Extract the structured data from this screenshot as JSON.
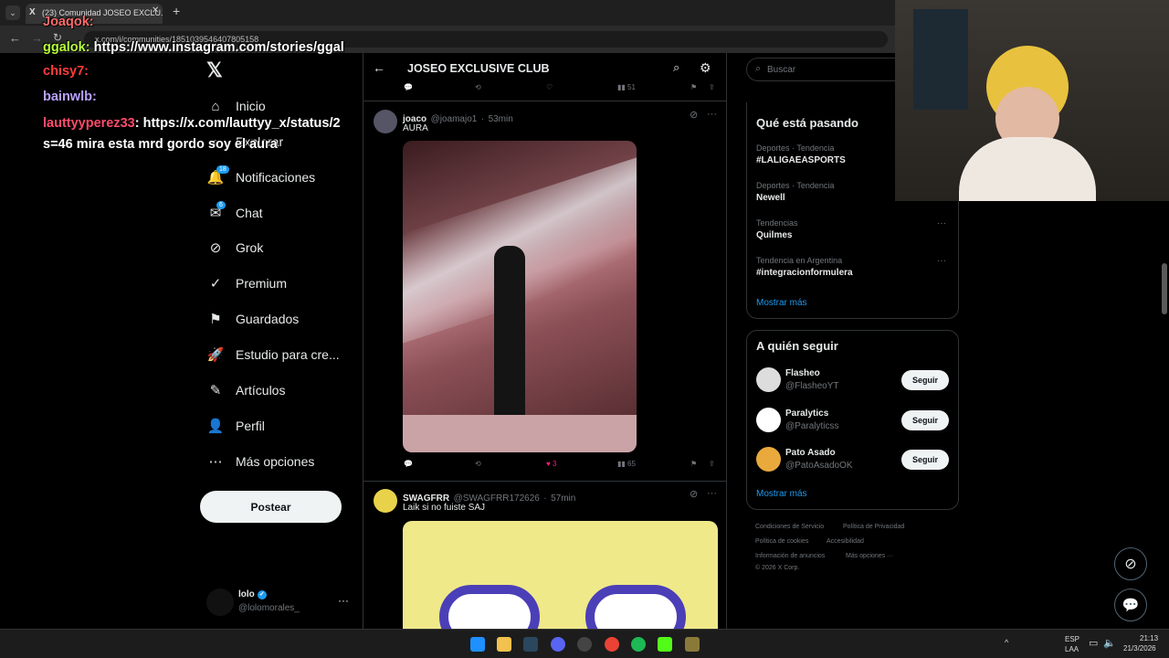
{
  "browser": {
    "tab_title": "(23) Comunidad JOSEO EXCLU...",
    "url": "x.com/i/communities/1851039546407805158"
  },
  "sidebar": {
    "items": [
      {
        "label": "Inicio",
        "icon": "home-icon"
      },
      {
        "label": "Explorar",
        "icon": "search-icon"
      },
      {
        "label": "Notificaciones",
        "icon": "bell-icon",
        "badge": "18"
      },
      {
        "label": "Chat",
        "icon": "mail-icon",
        "badge": "6"
      },
      {
        "label": "Grok",
        "icon": "grok-icon"
      },
      {
        "label": "Premium",
        "icon": "verified-icon"
      },
      {
        "label": "Guardados",
        "icon": "bookmark-icon"
      },
      {
        "label": "Estudio para cre...",
        "icon": "rocket-icon"
      },
      {
        "label": "Artículos",
        "icon": "articles-icon"
      },
      {
        "label": "Perfil",
        "icon": "person-icon"
      },
      {
        "label": "Más opciones",
        "icon": "more-icon"
      }
    ],
    "post_label": "Postear",
    "account_name": "lolo",
    "account_handle": "@lolomorales_"
  },
  "community": {
    "title": "JOSEO EXCLUSIVE CLUB"
  },
  "top_actions": {
    "views": "51"
  },
  "tweets": [
    {
      "name": "joaco",
      "handle": "@joamajo1",
      "time": "53min",
      "text": "AURA",
      "likes": "3",
      "views": "65"
    },
    {
      "name": "SWAGFRR",
      "handle": "@SWAGFRR172626",
      "time": "57min",
      "text": "Laik si no fuiste SAJ"
    }
  ],
  "search": {
    "placeholder": "Buscar"
  },
  "trends": {
    "title": "Qué está pasando",
    "items": [
      {
        "context": "Deportes · Tendencia",
        "name": "#LALIGAEASPORTS"
      },
      {
        "context": "Deportes · Tendencia",
        "name": "Newell"
      },
      {
        "context": "Tendencias",
        "name": "Quilmes"
      },
      {
        "context": "Tendencia en Argentina",
        "name": "#integracionformulera"
      }
    ],
    "show_more": "Mostrar más"
  },
  "who_to_follow": {
    "title": "A quién seguir",
    "items": [
      {
        "name": "Flasheo",
        "handle": "@FlasheoYT",
        "button": "Seguir"
      },
      {
        "name": "Paralytics",
        "handle": "@Paralyticss",
        "button": "Seguir"
      },
      {
        "name": "Pato Asado",
        "handle": "@PatoAsadoOK",
        "button": "Seguir"
      }
    ],
    "show_more": "Mostrar más"
  },
  "footer": {
    "links": [
      "Condiciones de Servicio",
      "Política de Privacidad",
      "Política de cookies",
      "Accesibilidad",
      "Información de anuncios",
      "Más opciones ···"
    ],
    "copyright": "© 2026 X Corp."
  },
  "chat_overlay": [
    {
      "user": "Joaqok:",
      "color": "#ff6b6b",
      "text": ""
    },
    {
      "user": "ggalok:",
      "color": "#b6ff3b",
      "text": " https://www.instagram.com/stories/ggal"
    },
    {
      "user": "chisy7:",
      "color": "#ff3b3b",
      "text": ""
    },
    {
      "user": "bainwlb:",
      "color": "#b9a2ff",
      "text": ""
    },
    {
      "user": "lauttyyperez33",
      "color": "#ff4a6b",
      "text": ": https://x.com/lauttyy_x/status/2"
    },
    {
      "user": "",
      "color": "#fff",
      "text": "s=46 mira esta mrd gordo soy el aura"
    }
  ],
  "taskbar": {
    "lang": "ESP",
    "layout": "LAA",
    "time": "21:13",
    "date": "21/3/2026"
  },
  "colors": {
    "accent": "#1d9bf0",
    "like": "#f91880"
  }
}
